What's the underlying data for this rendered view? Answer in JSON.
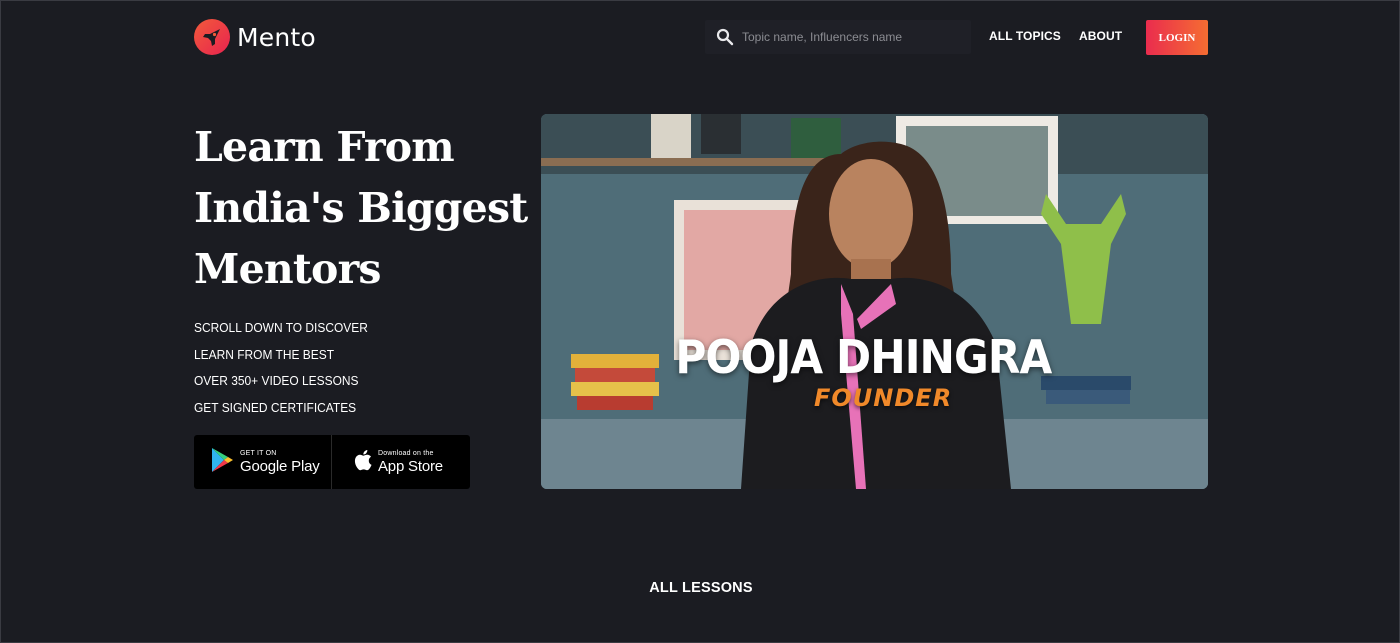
{
  "header": {
    "logo_text": "Mento",
    "search_placeholder": "Topic name, Influencers name",
    "nav": {
      "all_topics": "ALL TOPICS",
      "about": "ABOUT"
    },
    "login_label": "LOGIN"
  },
  "hero": {
    "title_lines": [
      "Learn From",
      "India's Biggest",
      "Mentors"
    ],
    "features": [
      "SCROLL DOWN TO DISCOVER",
      "LEARN FROM THE BEST",
      "OVER 350+ VIDEO LESSONS",
      "GET SIGNED CERTIFICATES"
    ],
    "google_play": {
      "small": "GET IT ON",
      "big": "Google Play"
    },
    "app_store": {
      "small": "Download on the",
      "big": "App Store"
    },
    "video": {
      "name": "POOJA DHINGRA",
      "role": "FOUNDER"
    }
  },
  "sections": {
    "all_lessons": "ALL LESSONS"
  },
  "colors": {
    "background": "#1b1c22",
    "accent_start": "#ea2c4e",
    "accent_end": "#f56d32",
    "role_orange": "#f0892a"
  }
}
